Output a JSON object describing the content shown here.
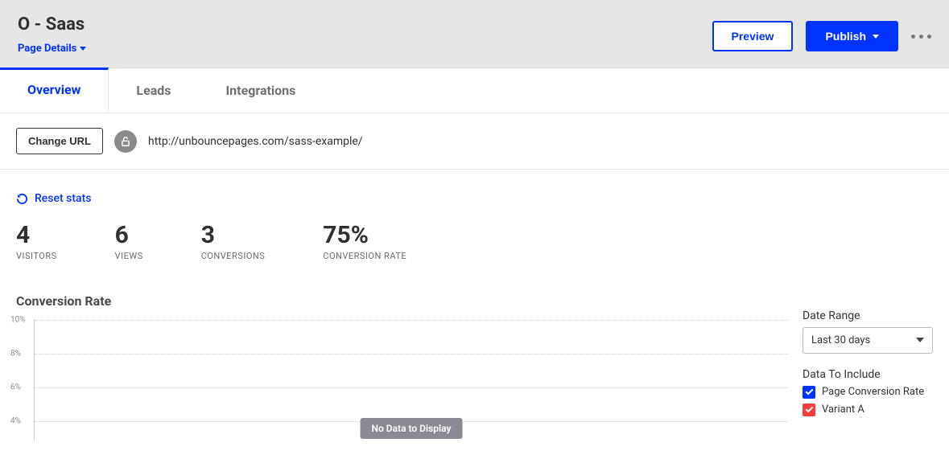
{
  "header": {
    "title": "O - Saas",
    "page_details_label": "Page Details",
    "preview_label": "Preview",
    "publish_label": "Publish"
  },
  "tabs": [
    {
      "label": "Overview",
      "active": true
    },
    {
      "label": "Leads",
      "active": false
    },
    {
      "label": "Integrations",
      "active": false
    }
  ],
  "url_row": {
    "change_url_label": "Change URL",
    "url": "http://unbouncepages.com/sass-example/"
  },
  "reset_label": "Reset stats",
  "stats": {
    "visitors": {
      "value": "4",
      "label": "VISITORS"
    },
    "views": {
      "value": "6",
      "label": "VIEWS"
    },
    "conversions": {
      "value": "3",
      "label": "CONVERSIONS"
    },
    "conversion_rate": {
      "value": "75%",
      "label": "CONVERSION RATE"
    }
  },
  "chart": {
    "title": "Conversion Rate",
    "no_data_label": "No Data to Display"
  },
  "chart_data": {
    "type": "line",
    "title": "Conversion Rate",
    "xlabel": "",
    "ylabel": "",
    "ylim": [
      0,
      10
    ],
    "y_ticks": [
      "10%",
      "8%",
      "6%",
      "4%"
    ],
    "series": [
      {
        "name": "Page Conversion Rate",
        "values": []
      },
      {
        "name": "Variant A",
        "values": []
      }
    ],
    "note": "No data displayed"
  },
  "controls": {
    "date_range_label": "Date Range",
    "date_range_value": "Last 30 days",
    "data_include_label": "Data To Include",
    "include_options": [
      {
        "label": "Page Conversion Rate",
        "color": "blue",
        "checked": true
      },
      {
        "label": "Variant A",
        "color": "red",
        "checked": true
      }
    ]
  }
}
